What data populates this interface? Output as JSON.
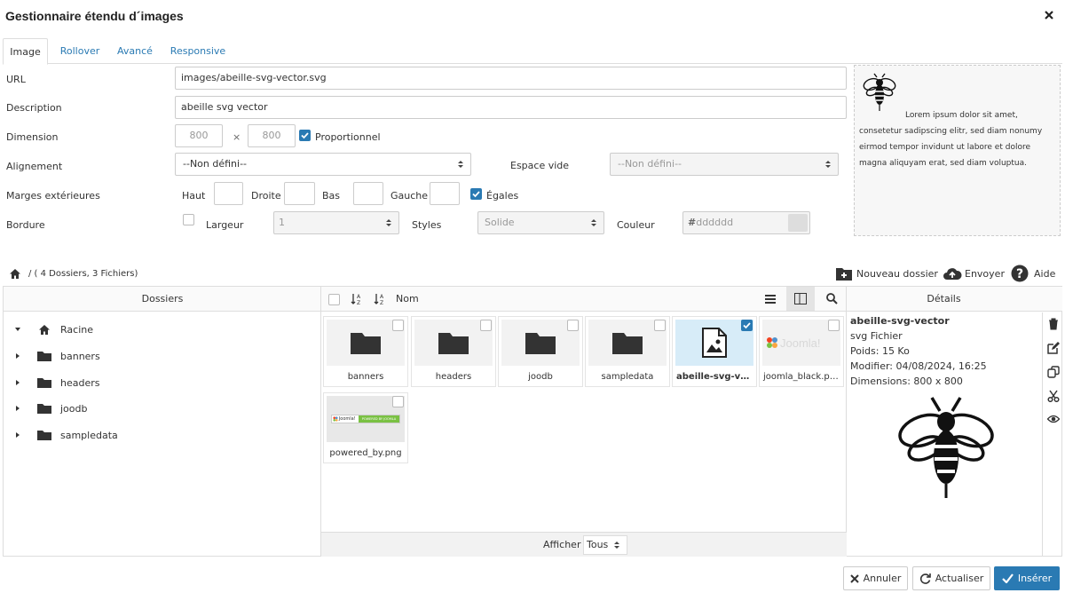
{
  "dialog": {
    "title": "Gestionnaire étendu d´images",
    "close_icon": "close-icon"
  },
  "tabs": [
    {
      "label": "Image",
      "active": true
    },
    {
      "label": "Rollover",
      "active": false
    },
    {
      "label": "Avancé",
      "active": false
    },
    {
      "label": "Responsive",
      "active": false
    }
  ],
  "form": {
    "url": {
      "label": "URL",
      "value": "images/abeille-svg-vector.svg"
    },
    "description": {
      "label": "Description",
      "value": "abeille svg vector"
    },
    "dimension": {
      "label": "Dimension",
      "width_placeholder": "800",
      "separator": "×",
      "height_placeholder": "800",
      "proportional_label": "Proportionnel",
      "proportional_checked": true
    },
    "alignment": {
      "label": "Alignement",
      "value": "--Non défini--",
      "space_label": "Espace vide",
      "space_value": "--Non défini--"
    },
    "margins": {
      "label": "Marges extérieures",
      "top": "Haut",
      "right": "Droite",
      "bottom": "Bas",
      "left": "Gauche",
      "equal_label": "Égales",
      "equal_checked": true
    },
    "border": {
      "label": "Bordure",
      "width_label": "Largeur",
      "width_value": "1",
      "styles_label": "Styles",
      "styles_value": "Solide",
      "color_label": "Couleur",
      "color_placeholder": "dddddd",
      "color_hash": "#",
      "color_swatch": "#dddddd"
    }
  },
  "preview": {
    "text": "Lorem ipsum dolor sit amet, consetetur sadipscing elitr, sed diam nonumy eirmod tempor invidunt ut labore et dolore magna aliquyam erat, sed diam voluptua."
  },
  "browser": {
    "path": "/ ( 4 Dossiers, 3 Fichiers)",
    "new_folder": "Nouveau dossier",
    "upload": "Envoyer",
    "help": "Aide",
    "folders_header": "Dossiers",
    "sort_label": "Nom",
    "details_header": "Détails",
    "tree": [
      {
        "label": "Racine",
        "icon": "home-icon"
      },
      {
        "label": "banners",
        "icon": "folder-icon"
      },
      {
        "label": "headers",
        "icon": "folder-icon"
      },
      {
        "label": "joodb",
        "icon": "folder-icon"
      },
      {
        "label": "sampledata",
        "icon": "folder-icon"
      }
    ],
    "files": [
      {
        "name": "banners",
        "type": "folder"
      },
      {
        "name": "headers",
        "type": "folder"
      },
      {
        "name": "joodb",
        "type": "folder"
      },
      {
        "name": "sampledata",
        "type": "folder"
      },
      {
        "name": "abeille-svg-vect...",
        "type": "image",
        "selected": true
      },
      {
        "name": "joomla_black.png",
        "type": "image"
      },
      {
        "name": "powered_by.png",
        "type": "image"
      }
    ],
    "show_label": "Afficher",
    "show_value": "Tous",
    "details": {
      "name": "abeille-svg-vector",
      "type": "svg Fichier",
      "size": "Poids: 15 Ko",
      "modified": "Modifier: 04/08/2024, 16:25",
      "dimensions": "Dimensions: 800 x 800"
    },
    "joomla_logo_text": "Joomla!",
    "powered_text": "POWERED BY JOOMLA"
  },
  "buttons": {
    "cancel": "Annuler",
    "refresh": "Actualiser",
    "insert": "Insérer"
  },
  "colors": {
    "accent": "#2a7ab3",
    "folder": "#333333"
  }
}
